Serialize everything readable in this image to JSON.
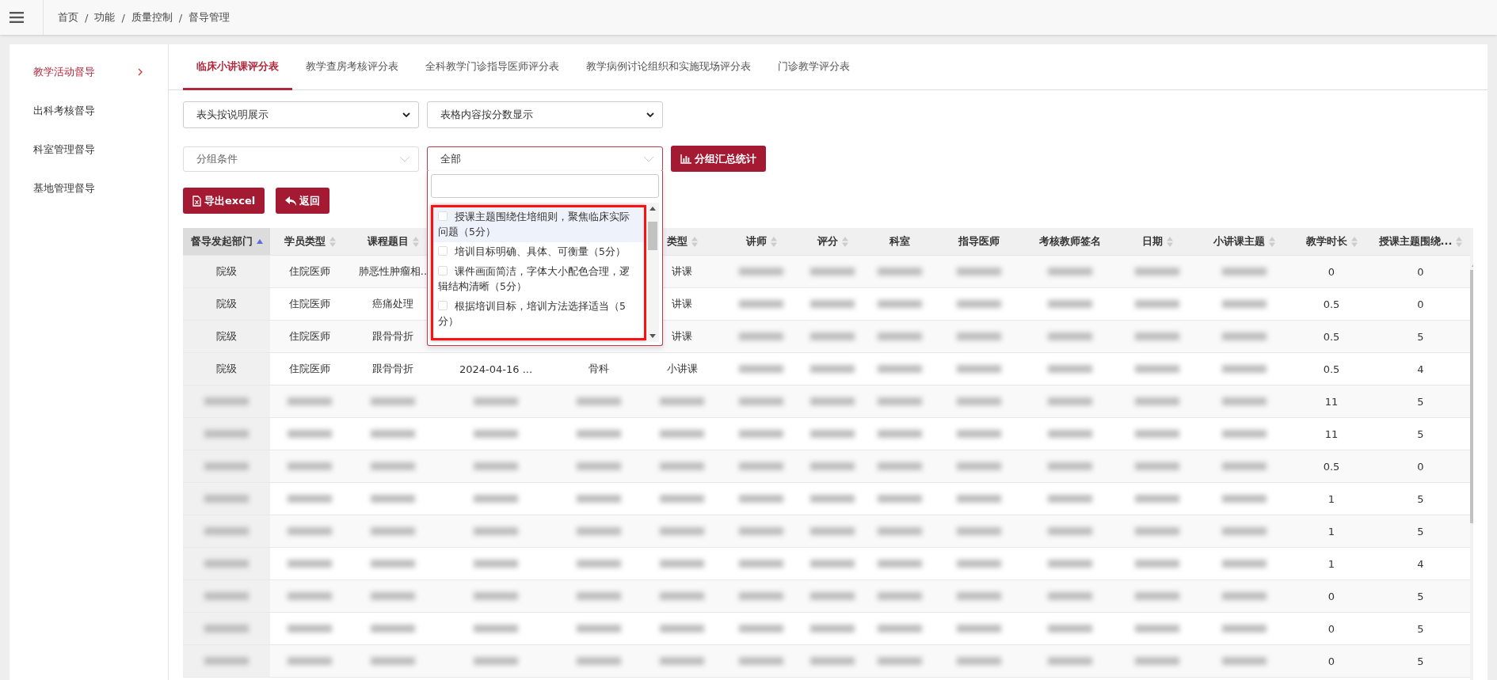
{
  "breadcrumb": {
    "separator": "/",
    "items": [
      "首页",
      "功能",
      "质量控制",
      "督导管理"
    ]
  },
  "sidebar": {
    "items": [
      {
        "label": "教学活动督导",
        "selected": true
      },
      {
        "label": "出科考核督导",
        "selected": false
      },
      {
        "label": "科室管理督导",
        "selected": false
      },
      {
        "label": "基地管理督导",
        "selected": false
      }
    ]
  },
  "tabs": [
    {
      "label": "临床小讲课评分表",
      "selected": true
    },
    {
      "label": "教学查房考核评分表",
      "selected": false
    },
    {
      "label": "全科教学门诊指导医师评分表",
      "selected": false
    },
    {
      "label": "教学病例讨论组织和实施现场评分表",
      "selected": false
    },
    {
      "label": "门诊教学评分表",
      "selected": false
    }
  ],
  "display_selects": [
    "表头按说明展示",
    "表格内容按分数显示"
  ],
  "group_select": {
    "placeholder": "分组条件"
  },
  "filter_select": {
    "value": "全部",
    "open": true,
    "options": [
      {
        "label": "授课主题围绕住培细则，聚焦临床实际问题（5分）",
        "checked": false,
        "hovered": true
      },
      {
        "label": "培训目标明确、具体、可衡量（5分）",
        "checked": false,
        "hovered": false
      },
      {
        "label": "课件画面简洁，字体大小配色合理，逻辑结构清晰（5分）",
        "checked": false,
        "hovered": false
      },
      {
        "label": "根据培训目标，培训方法选择适当（5分）",
        "checked": false,
        "hovered": false
      }
    ]
  },
  "buttons": {
    "group_stats": "分组汇总统计",
    "export": "导出excel",
    "back": "返回"
  },
  "table": {
    "columns": [
      {
        "label": "督导发起部门",
        "sortable": true,
        "sorted_ascending": true
      },
      {
        "label": "学员类型",
        "sortable": true
      },
      {
        "label": "课程题目",
        "sortable": true
      },
      {},
      {},
      {
        "label": "类型",
        "sortable": true
      },
      {
        "label": "讲师",
        "sortable": true
      },
      {
        "label": "评分",
        "sortable": true
      },
      {
        "label": "科室",
        "sortable": false
      },
      {
        "label": "指导医师",
        "sortable": false
      },
      {
        "label": "考核教师签名",
        "sortable": false
      },
      {
        "label": "日期",
        "sortable": true
      },
      {
        "label": "小讲课主题",
        "sortable": true
      },
      {
        "label": "教学时长",
        "sortable": true
      },
      {
        "label": "授课主题围绕...",
        "sortable": true
      }
    ],
    "rows": [
      [
        "院级",
        "住院医师",
        "肺恶性肿瘤相..",
        false,
        false,
        "讲课",
        null,
        null,
        null,
        null,
        null,
        null,
        null,
        "0",
        "0"
      ],
      [
        "院级",
        "住院医师",
        "癌痛处理",
        false,
        false,
        "讲课",
        null,
        null,
        null,
        null,
        null,
        null,
        null,
        "0.5",
        "0"
      ],
      [
        "院级",
        "住院医师",
        "跟骨骨折",
        false,
        false,
        "讲课",
        null,
        null,
        null,
        null,
        null,
        null,
        null,
        "0.5",
        "5"
      ],
      [
        "院级",
        "住院医师",
        "跟骨骨折",
        "2024-04-16 ...",
        "骨科",
        "小讲课",
        null,
        null,
        null,
        null,
        null,
        null,
        null,
        "0.5",
        "4"
      ],
      [
        null,
        null,
        null,
        null,
        null,
        null,
        null,
        null,
        null,
        null,
        null,
        null,
        null,
        "11",
        "5"
      ],
      [
        null,
        null,
        null,
        null,
        null,
        null,
        null,
        null,
        null,
        null,
        null,
        null,
        null,
        "11",
        "5"
      ],
      [
        null,
        null,
        null,
        null,
        null,
        null,
        null,
        null,
        null,
        null,
        null,
        null,
        null,
        "0.5",
        "0"
      ],
      [
        null,
        null,
        null,
        null,
        null,
        null,
        null,
        null,
        null,
        null,
        null,
        null,
        null,
        "1",
        "5"
      ],
      [
        null,
        null,
        null,
        null,
        null,
        null,
        null,
        null,
        null,
        null,
        null,
        null,
        null,
        "1",
        "5"
      ],
      [
        null,
        null,
        null,
        null,
        null,
        null,
        null,
        null,
        null,
        null,
        null,
        null,
        null,
        "1",
        "4"
      ],
      [
        null,
        null,
        null,
        null,
        null,
        null,
        null,
        null,
        null,
        null,
        null,
        null,
        null,
        "0",
        "5"
      ],
      [
        null,
        null,
        null,
        null,
        null,
        null,
        null,
        null,
        null,
        null,
        null,
        null,
        null,
        "0",
        "5"
      ],
      [
        null,
        null,
        null,
        null,
        null,
        null,
        null,
        null,
        null,
        null,
        null,
        null,
        null,
        "0",
        "5"
      ]
    ]
  }
}
